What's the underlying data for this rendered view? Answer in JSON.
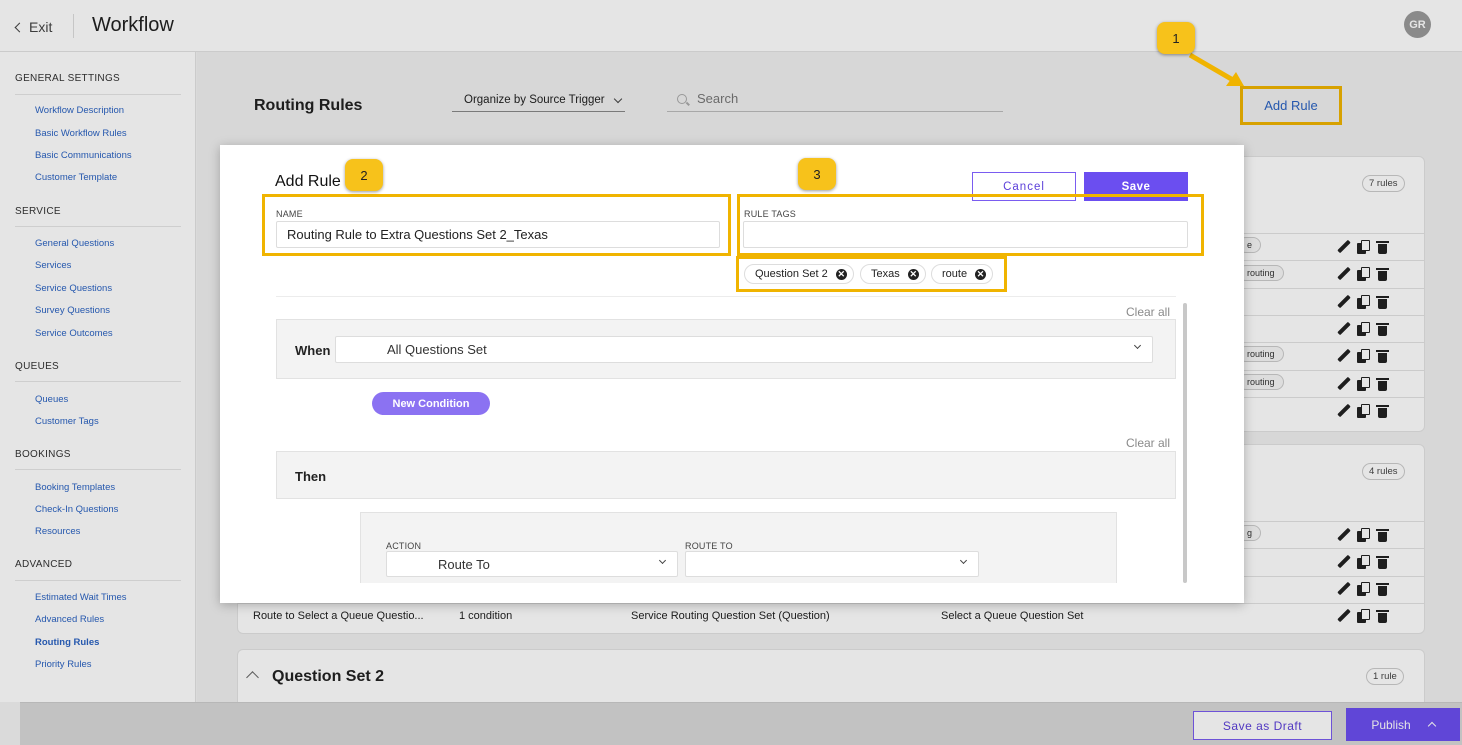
{
  "topbar": {
    "exit_label": "Exit",
    "title": "Workflow",
    "avatar_initials": "GR"
  },
  "sidebar": {
    "sections": [
      {
        "title": "GENERAL SETTINGS",
        "items": [
          "Workflow Description",
          "Basic Workflow Rules",
          "Basic Communications",
          "Customer Template"
        ]
      },
      {
        "title": "SERVICE",
        "items": [
          "General Questions",
          "Services",
          "Service Questions",
          "Survey Questions",
          "Service Outcomes"
        ]
      },
      {
        "title": "QUEUES",
        "items": [
          "Queues",
          "Customer Tags"
        ]
      },
      {
        "title": "BOOKINGS",
        "items": [
          "Booking Templates",
          "Check-In Questions",
          "Resources"
        ]
      },
      {
        "title": "ADVANCED",
        "items": [
          "Estimated Wait Times",
          "Advanced Rules",
          "Routing Rules",
          "Priority Rules"
        ]
      }
    ],
    "active_item": "Routing Rules"
  },
  "main": {
    "title": "Routing Rules",
    "organize_label": "Organize by Source Trigger",
    "search_placeholder": "Search",
    "add_rule_label": "Add Rule",
    "group1_count": "7 rules",
    "group2_count": "4 rules",
    "group3_title": "Question Set 2",
    "group3_count": "1 rule",
    "visible_row": {
      "name": "Route to Select a Queue Questio...",
      "conditions": "1 condition",
      "trigger": "Service Routing Question Set (Question)",
      "target": "Select a Queue Question Set"
    },
    "tag_fragments": [
      "e",
      "routing",
      "routing",
      "routing",
      "g"
    ]
  },
  "callouts": [
    "1",
    "2",
    "3"
  ],
  "modal": {
    "title": "Add Rule",
    "cancel_label": "Cancel",
    "save_label": "Save",
    "name_label": "NAME",
    "name_value": "Routing Rule to Extra Questions Set 2_Texas",
    "tags_label": "RULE TAGS",
    "tags_value": "",
    "tags": [
      "Question Set 2",
      "Texas",
      "route"
    ],
    "clear_all_label": "Clear all",
    "when_label": "When",
    "when_value": "All Questions Set",
    "new_condition_label": "New Condition",
    "then_label": "Then",
    "action_label": "ACTION",
    "action_value": "Route To",
    "route_to_label": "ROUTE TO",
    "route_to_value": ""
  },
  "footer": {
    "save_draft_label": "Save as Draft",
    "publish_label": "Publish"
  },
  "colors": {
    "accent": "#6b4ef0",
    "highlight": "#f0b400",
    "callout": "#f7c21b",
    "link": "#2b63c2"
  }
}
